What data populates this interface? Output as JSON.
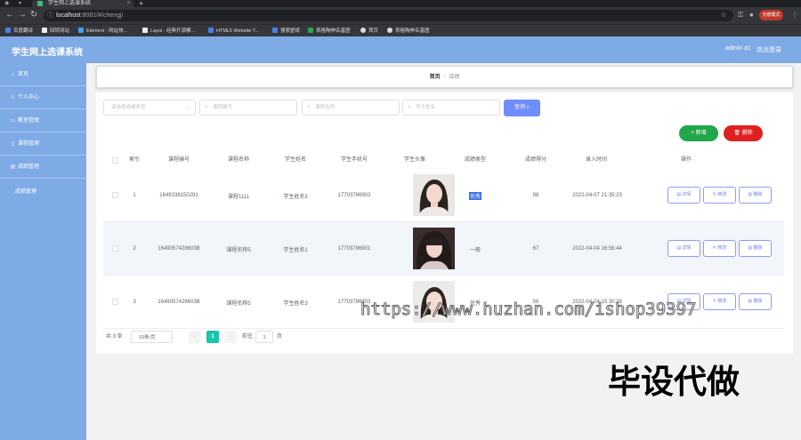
{
  "browser": {
    "tab_title": "学生网上选课系统",
    "url_host": "localhost",
    "url_rest": ":8081/#/chengji",
    "incognito_label": "无痕模式",
    "bookmarks": [
      "百度翻译",
      "回转网站",
      "Element - 网站快...",
      "Layui - 经典开源模...",
      "HTML5 Website T...",
      "搜索壁纸",
      "表格陶伸名基图",
      "首页",
      "表格陶伸名基图"
    ]
  },
  "header": {
    "title": "学生网上选课系统",
    "user": "admin a1",
    "logout": "退出登录"
  },
  "sidebar": {
    "items": [
      {
        "label": "首页",
        "icon": "home-icon"
      },
      {
        "label": "个人中心",
        "icon": "user-icon"
      },
      {
        "label": "教室管理",
        "icon": "folder-icon"
      },
      {
        "label": "课程管理",
        "icon": "document-icon"
      },
      {
        "label": "成绩管理",
        "icon": "chart-icon"
      }
    ],
    "sub_item": "成绩管理"
  },
  "breadcrumb": {
    "home": "首页",
    "separator": "/",
    "current": "成绩"
  },
  "filters": {
    "select_placeholder": "请选择成绩类型",
    "course_no_placeholder": "课程编号",
    "course_name_placeholder": "课程名称",
    "student_name_placeholder": "学生姓名",
    "query_label": "查询"
  },
  "actions": {
    "add_label": "新增",
    "delete_label": "删除"
  },
  "table": {
    "headers": [
      "索引",
      "课程编号",
      "课程名称",
      "学生姓名",
      "学生手机号",
      "学生头像",
      "成绩类型",
      "成绩得分",
      "录入时间",
      "操作"
    ],
    "rows": [
      {
        "index": "1",
        "course_no": "1649338150291",
        "course_name": "课程1111",
        "student_name": "学生姓名3",
        "phone": "17703786903",
        "grade_type": "优秀",
        "score": "98",
        "time": "2022-04-07 21:35:23"
      },
      {
        "index": "2",
        "course_no": "1649057428603B",
        "course_name": "课程名称5",
        "student_name": "学生姓名1",
        "phone": "17703786901",
        "grade_type": "一般",
        "score": "67",
        "time": "2022-04-04 16:56:44"
      },
      {
        "index": "3",
        "course_no": "1649057428603B",
        "course_name": "课程名称5",
        "student_name": "学生姓名3",
        "phone": "17703786903",
        "grade_type": "优秀",
        "score": "56",
        "time": "2022-04-04 15:30:28"
      }
    ],
    "op_detail": "详情",
    "op_edit": "修改",
    "op_delete": "删除"
  },
  "pagination": {
    "total": "共 3 条",
    "page_size": "10条/页",
    "current_page": "1",
    "goto_label": "前往",
    "goto_value": "1",
    "page_suffix": "页"
  },
  "overlay": {
    "watermark": "https://www.huzhan.com/ishop39397",
    "caption": "毕设代做"
  }
}
